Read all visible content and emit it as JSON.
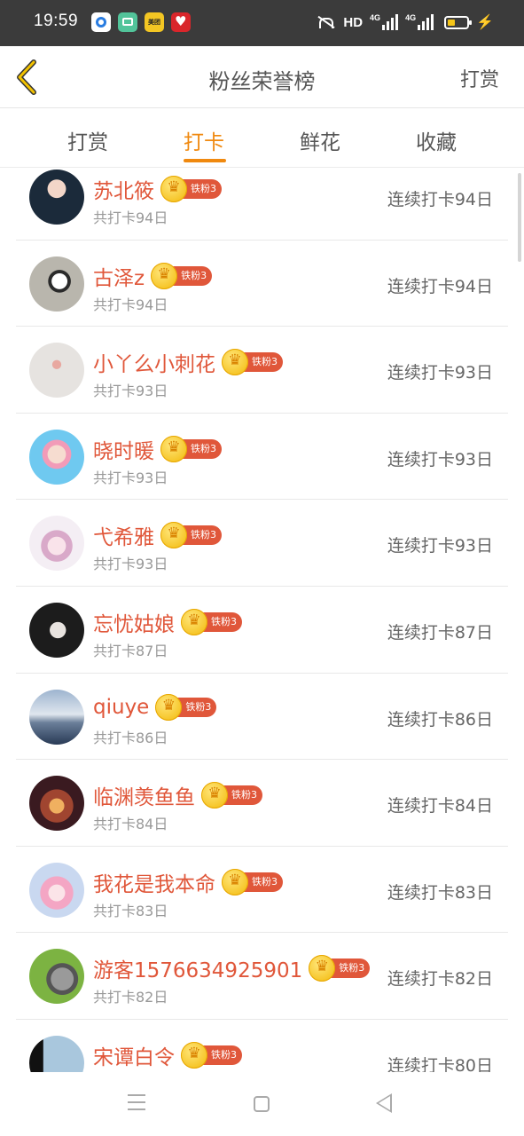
{
  "status_bar": {
    "time": "19:59",
    "app_icon_label": "美团",
    "hd": "HD",
    "net_1": "4G",
    "net_2": "4G",
    "battery_level": 0.4
  },
  "header": {
    "title": "粉丝荣誉榜",
    "action": "打赏",
    "back_icon": "chevron-left-icon"
  },
  "tabs": [
    {
      "label": "打赏",
      "active": false
    },
    {
      "label": "打卡",
      "active": true
    },
    {
      "label": "鲜花",
      "active": false
    },
    {
      "label": "收藏",
      "active": false
    }
  ],
  "accent_color": "#f0890f",
  "name_color": "#e0573a",
  "fans": [
    {
      "name": "苏北筱",
      "badge": "铁粉3",
      "total": "共打卡94日",
      "streak": "连续打卡94日"
    },
    {
      "name": "古泽z",
      "badge": "铁粉3",
      "total": "共打卡94日",
      "streak": "连续打卡94日"
    },
    {
      "name": "小丫么小刺花",
      "badge": "铁粉3",
      "total": "共打卡93日",
      "streak": "连续打卡93日"
    },
    {
      "name": "晓时暖",
      "badge": "铁粉3",
      "total": "共打卡93日",
      "streak": "连续打卡93日"
    },
    {
      "name": "弋希雅",
      "badge": "铁粉3",
      "total": "共打卡93日",
      "streak": "连续打卡93日"
    },
    {
      "name": "忘忧姑娘",
      "badge": "铁粉3",
      "total": "共打卡87日",
      "streak": "连续打卡87日"
    },
    {
      "name": "qiuye",
      "badge": "铁粉3",
      "total": "共打卡86日",
      "streak": "连续打卡86日"
    },
    {
      "name": "临渊羡鱼鱼",
      "badge": "铁粉3",
      "total": "共打卡84日",
      "streak": "连续打卡84日"
    },
    {
      "name": "我花是我本命",
      "badge": "铁粉3",
      "total": "共打卡83日",
      "streak": "连续打卡83日"
    },
    {
      "name": "游客1576634925901",
      "badge": "铁粉3",
      "total": "共打卡82日",
      "streak": "连续打卡82日"
    },
    {
      "name": "宋谭白令",
      "badge": "铁粉3",
      "total": "",
      "streak": "连续打卡80日"
    }
  ],
  "nav_bar": {
    "menu_icon": "menu-icon",
    "home_icon": "home-icon",
    "back_icon": "back-triangle-icon"
  }
}
